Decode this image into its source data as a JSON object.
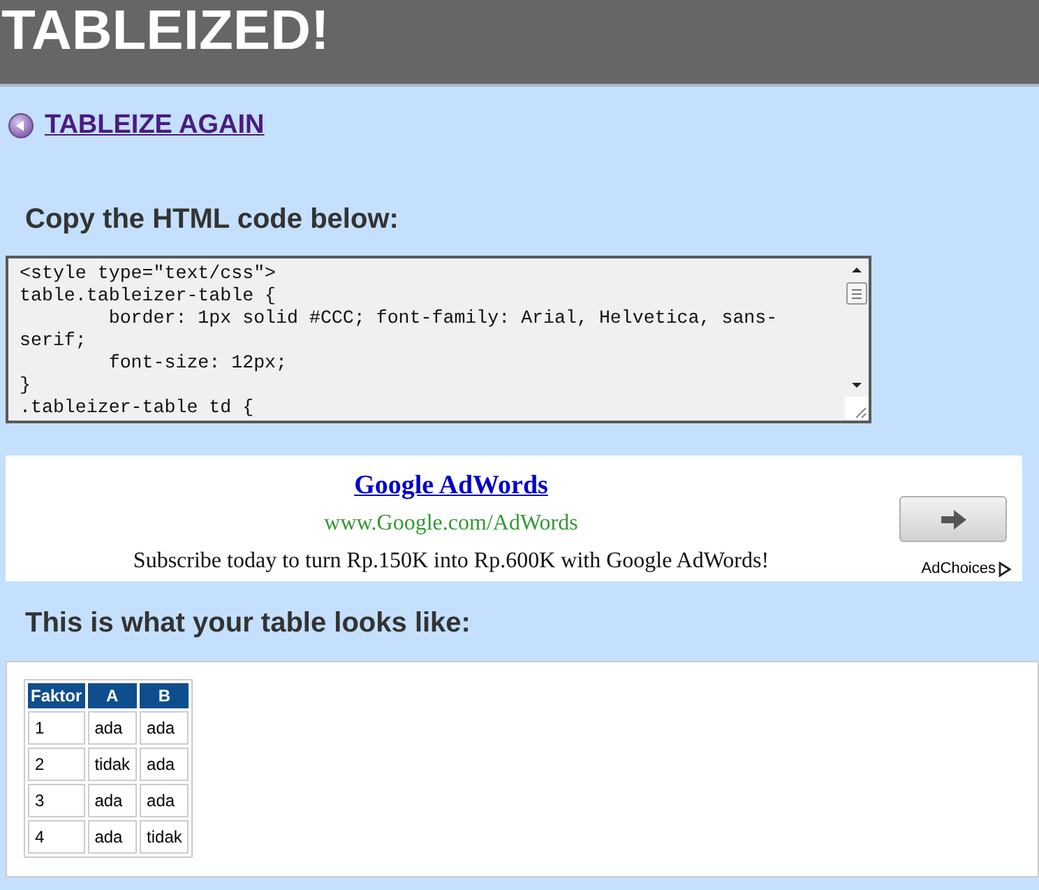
{
  "header": {
    "title": "TABLEIZED!"
  },
  "back_link": {
    "label": "TABLEIZE AGAIN"
  },
  "code_section": {
    "heading": "Copy the HTML code below:",
    "code_lines": [
      "<style type=\"text/css\">",
      "table.tableizer-table {",
      "\tborder: 1px solid #CCC; font-family: Arial, Helvetica, sans-",
      "serif;",
      "\tfont-size: 12px;",
      "}",
      ".tableizer-table td {"
    ]
  },
  "ad": {
    "title": "Google AdWords",
    "url": "www.Google.com/AdWords",
    "text": "Subscribe today to turn Rp.150K into Rp.600K with Google AdWords!",
    "adchoices": "AdChoices"
  },
  "preview_section": {
    "heading": "This is what your table looks like:",
    "table": {
      "columns": [
        "Faktor",
        "A",
        "B"
      ],
      "rows": [
        [
          "1",
          "ada",
          "ada"
        ],
        [
          "2",
          "tidak",
          "ada"
        ],
        [
          "3",
          "ada",
          "ada"
        ],
        [
          "4",
          "ada",
          "tidak"
        ]
      ]
    }
  }
}
